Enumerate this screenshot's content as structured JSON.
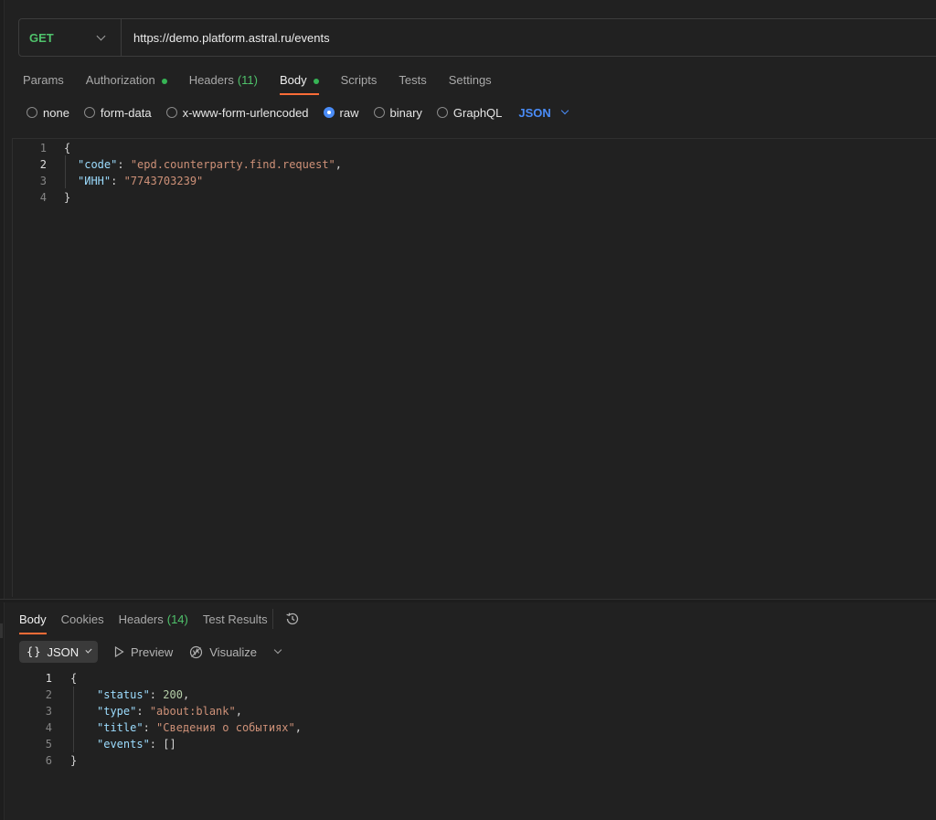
{
  "request": {
    "method": "GET",
    "url": "https://demo.platform.astral.ru/events"
  },
  "request_tabs": [
    {
      "label": "Params"
    },
    {
      "label": "Authorization",
      "dot": true
    },
    {
      "label": "Headers",
      "count": "(11)"
    },
    {
      "label": "Body",
      "dot": true,
      "active": true
    },
    {
      "label": "Scripts"
    },
    {
      "label": "Tests"
    },
    {
      "label": "Settings"
    }
  ],
  "body_types": {
    "options": [
      "none",
      "form-data",
      "x-www-form-urlencoded",
      "raw",
      "binary",
      "GraphQL"
    ],
    "selected": "raw",
    "language": "JSON"
  },
  "request_body": {
    "line_numbers": [
      "1",
      "2",
      "3",
      "4"
    ],
    "open_brace": "{",
    "close_brace": "}",
    "code_key": "\"code\"",
    "code_value": "\"epd.counterparty.find.request\"",
    "inn_key": "\"ИНН\"",
    "inn_value": "\"7743703239\""
  },
  "response_tabs": [
    {
      "label": "Body",
      "active": true
    },
    {
      "label": "Cookies"
    },
    {
      "label": "Headers",
      "count": "(14)"
    },
    {
      "label": "Test Results"
    }
  ],
  "response_toolbar": {
    "format_icon": "{}",
    "format": "JSON",
    "preview": "Preview",
    "visualize": "Visualize"
  },
  "response_body": {
    "line_numbers": [
      "1",
      "2",
      "3",
      "4",
      "5",
      "6"
    ],
    "open_brace": "{",
    "close_brace": "}",
    "status_key": "\"status\"",
    "status_value": "200",
    "type_key": "\"type\"",
    "type_value": "\"about:blank\"",
    "title_key": "\"title\"",
    "title_value": "\"Сведения о событиях\"",
    "events_key": "\"events\"",
    "events_value": "[]"
  },
  "colors": {
    "accent": "#ff6c37",
    "method_get": "#4fc26b",
    "link_blue": "#4a8cf7",
    "background": "#212121"
  },
  "icons": [
    "chevron-down-icon",
    "history-icon",
    "play-icon",
    "visualize-icon"
  ]
}
